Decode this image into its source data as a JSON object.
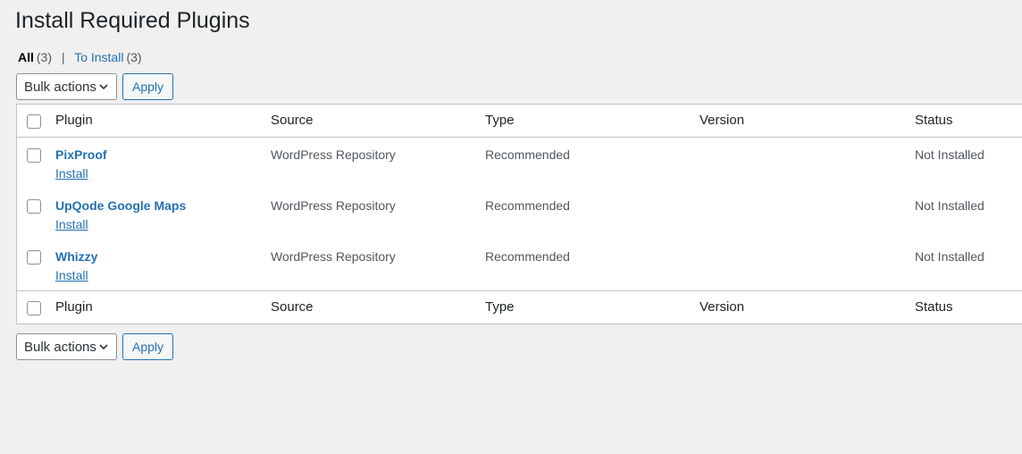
{
  "page": {
    "title": "Install Required Plugins"
  },
  "filters": {
    "all_label": "All",
    "all_count": "(3)",
    "separator": "|",
    "to_install_label": "To Install",
    "to_install_count": "(3)"
  },
  "bulk": {
    "select_value": "Bulk actions",
    "apply_label": "Apply"
  },
  "table": {
    "columns": [
      "Plugin",
      "Source",
      "Type",
      "Version",
      "Status"
    ],
    "rows": [
      {
        "name": "PixProof",
        "action": "Install",
        "source": "WordPress Repository",
        "type": "Recommended",
        "version": "",
        "status": "Not Installed"
      },
      {
        "name": "UpQode Google Maps",
        "action": "Install",
        "source": "WordPress Repository",
        "type": "Recommended",
        "version": "",
        "status": "Not Installed"
      },
      {
        "name": "Whizzy",
        "action": "Install",
        "source": "WordPress Repository",
        "type": "Recommended",
        "version": "",
        "status": "Not Installed"
      }
    ]
  },
  "colors": {
    "link": "#2271b1",
    "background": "#f0f0f1",
    "text": "#1d2327"
  }
}
